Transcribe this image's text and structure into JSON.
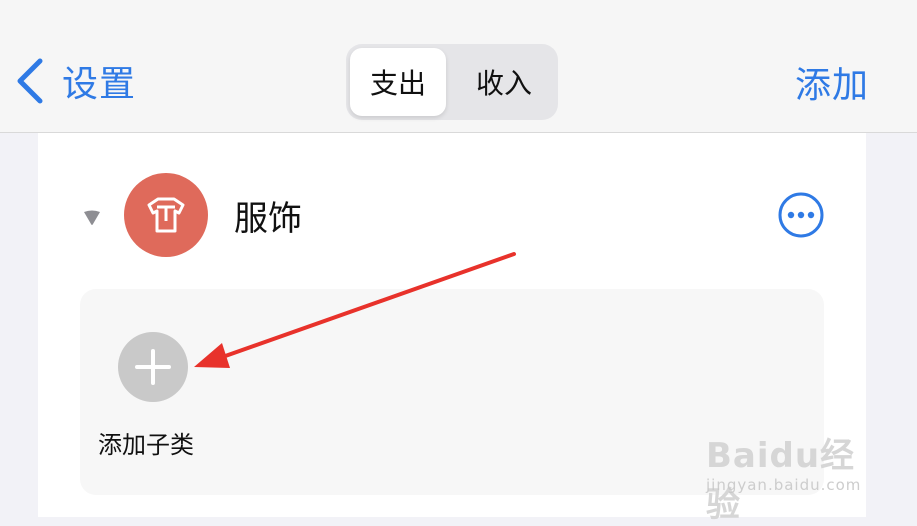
{
  "nav": {
    "back_label": "设置",
    "segments": [
      {
        "label": "支出",
        "selected": true
      },
      {
        "label": "收入",
        "selected": false
      }
    ],
    "add_label": "添加"
  },
  "category": {
    "name": "服饰",
    "icon": "shirt-icon",
    "icon_color": "#df6a5b",
    "expanded": true
  },
  "subcategory": {
    "add_label": "添加子类"
  },
  "accent_color": "#2f7ae5",
  "watermark": {
    "main": "Baidu经验",
    "sub": "jingyan.baidu.com"
  }
}
